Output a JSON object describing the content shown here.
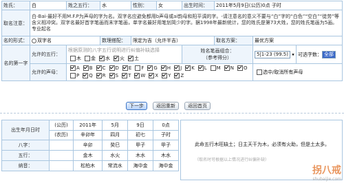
{
  "top": {
    "surname_label": "姓氏：",
    "surname": "白",
    "wuxing_label": "姓之五行：",
    "wuxing": "水",
    "gender_label": "性别：",
    "gender": "女",
    "birth_label": "出生时间：",
    "birth": "2011年5月9日(公历)0点  子时"
  },
  "note_label": "取名注意：",
  "note_text": "白-Bai-最好不用M.F.P为声母的字为名。双字名应避免都用b声母或ai韵母和阳平调的字。-请注意名的意义不要与“白”字的“白色”“空白”“徒劳”等含义相冲突。双字名最好首字笔画而末字笔画，单字名最好用笔划简少的字。据1998年最新统计，您的姓氏是第73大姓，您的姓氏笔画为5画。  专业起名",
  "row3": {
    "form_label": "名的形式：",
    "form": "双字名",
    "match_label": "数理搭配：",
    "match": "限定为吉（允许半吉）",
    "plan_label": "取名方案：",
    "plan": "最优方案"
  },
  "first": {
    "heading": "名的第一字",
    "wx_label": "允许的五行：",
    "wx_placeholder": "根据原测的八字五行说明进行纠偏补缺选择",
    "wx_options": [
      {
        "label": "木",
        "checked": false
      },
      {
        "label": "金",
        "checked": false
      },
      {
        "label": "水",
        "checked": true
      },
      {
        "label": "火",
        "checked": true
      },
      {
        "label": "土",
        "checked": true
      }
    ],
    "stroke_label": "姓名笔画组合：",
    "stroke_sub": "（参考得分）",
    "stroke_value": "5|1-23 (99.5)",
    "choose_label": "可选字数：",
    "choose_value": "全部",
    "sm_label": "允许的声母：",
    "sm_options": [
      {
        "label": "A",
        "checked": true
      },
      {
        "label": "B",
        "checked": true
      },
      {
        "label": "C",
        "checked": true
      },
      {
        "label": "D",
        "checked": true
      },
      {
        "label": "E",
        "checked": true
      },
      {
        "label": "F",
        "checked": false
      },
      {
        "label": "G",
        "checked": true
      },
      {
        "label": "H",
        "checked": true
      },
      {
        "label": "J",
        "checked": true
      },
      {
        "label": "K",
        "checked": true
      },
      {
        "label": "L",
        "checked": true
      },
      {
        "label": "M",
        "checked": false
      },
      {
        "label": "N",
        "checked": true
      },
      {
        "label": "O",
        "checked": true
      },
      {
        "label": "P",
        "checked": false
      },
      {
        "label": "Q",
        "checked": true
      },
      {
        "label": "R",
        "checked": true
      },
      {
        "label": "S",
        "checked": true
      },
      {
        "label": "T",
        "checked": true
      },
      {
        "label": "W",
        "checked": true
      },
      {
        "label": "X",
        "checked": true
      },
      {
        "label": "Y",
        "checked": true
      },
      {
        "label": "Z",
        "checked": true
      }
    ],
    "toggle_label": "选中/取消所有声母"
  },
  "buttons": {
    "next": "下一步",
    "back": "返回重新",
    "home": "返回首页"
  },
  "bazi": {
    "birth_label": "出生年月日时",
    "gong_label": "(公历)",
    "gong": [
      "2011年",
      "5月",
      "9日",
      "0点"
    ],
    "nong_label": "(农历)",
    "nong": [
      "辛卯年",
      "四月",
      "初七",
      "子时"
    ],
    "rows": [
      {
        "label": "八字：",
        "cells": [
          "辛卯",
          "癸巳",
          "甲子",
          "甲子"
        ]
      },
      {
        "label": "五行：",
        "cells": [
          "金木",
          "水火",
          "木水",
          "木水"
        ]
      },
      {
        "label": "纳音：",
        "cells": [
          "松柏木",
          "常流水",
          "海中金",
          "海中金"
        ]
      }
    ]
  },
  "side": {
    "line1": "此命五行木旺缺土；日主天干为木，必须有火助，但是土太多。",
    "hint": "（取名时可根据以上情况进行纠偏补缺）"
  },
  "watermark": {
    "brand": "拐八戒",
    "url": "shubaijie.com"
  }
}
